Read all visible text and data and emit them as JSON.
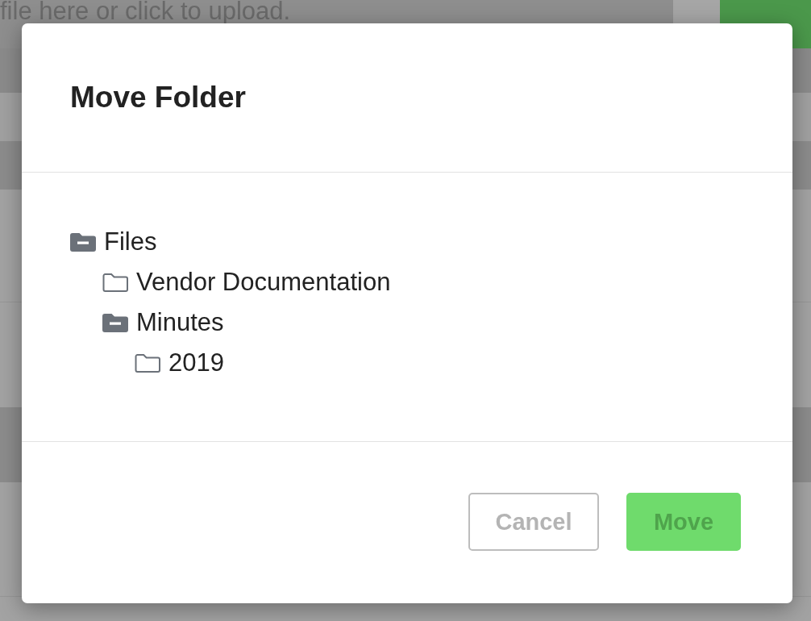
{
  "background": {
    "upload_hint": "file here or click to upload."
  },
  "dialog": {
    "title": "Move Folder",
    "tree": [
      {
        "label": "Files",
        "expanded": true,
        "children": [
          {
            "label": "Vendor Documentation",
            "expanded": false
          },
          {
            "label": "Minutes",
            "expanded": true,
            "children": [
              {
                "label": "2019",
                "expanded": false
              }
            ]
          }
        ]
      }
    ],
    "buttons": [
      {
        "label": "Cancel",
        "kind": "secondary"
      },
      {
        "label": "Move",
        "kind": "primary"
      }
    ]
  }
}
